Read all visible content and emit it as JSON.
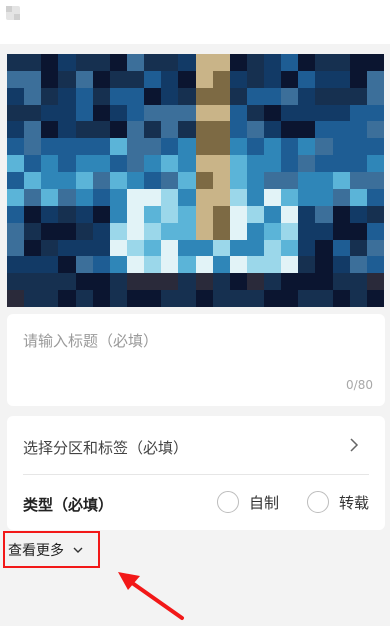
{
  "cover": {
    "palette": [
      "#0b1530",
      "#123a66",
      "#1e5d94",
      "#2f86b8",
      "#5bb4d8",
      "#9bd7ea",
      "#e2f3f7",
      "#163050",
      "#7d6a44",
      "#c9b488",
      "#2a2a3a",
      "#3c6f9a"
    ]
  },
  "title_field": {
    "placeholder": "请输入标题（必填）",
    "counter": "0/80"
  },
  "category": {
    "label": "选择分区和标签（必填）"
  },
  "type_row": {
    "label": "类型（必填）",
    "options": [
      "自制",
      "转载"
    ]
  },
  "more": {
    "label": "查看更多"
  },
  "colors": {
    "highlight": "#f21818",
    "background": "#f3f3f3"
  }
}
